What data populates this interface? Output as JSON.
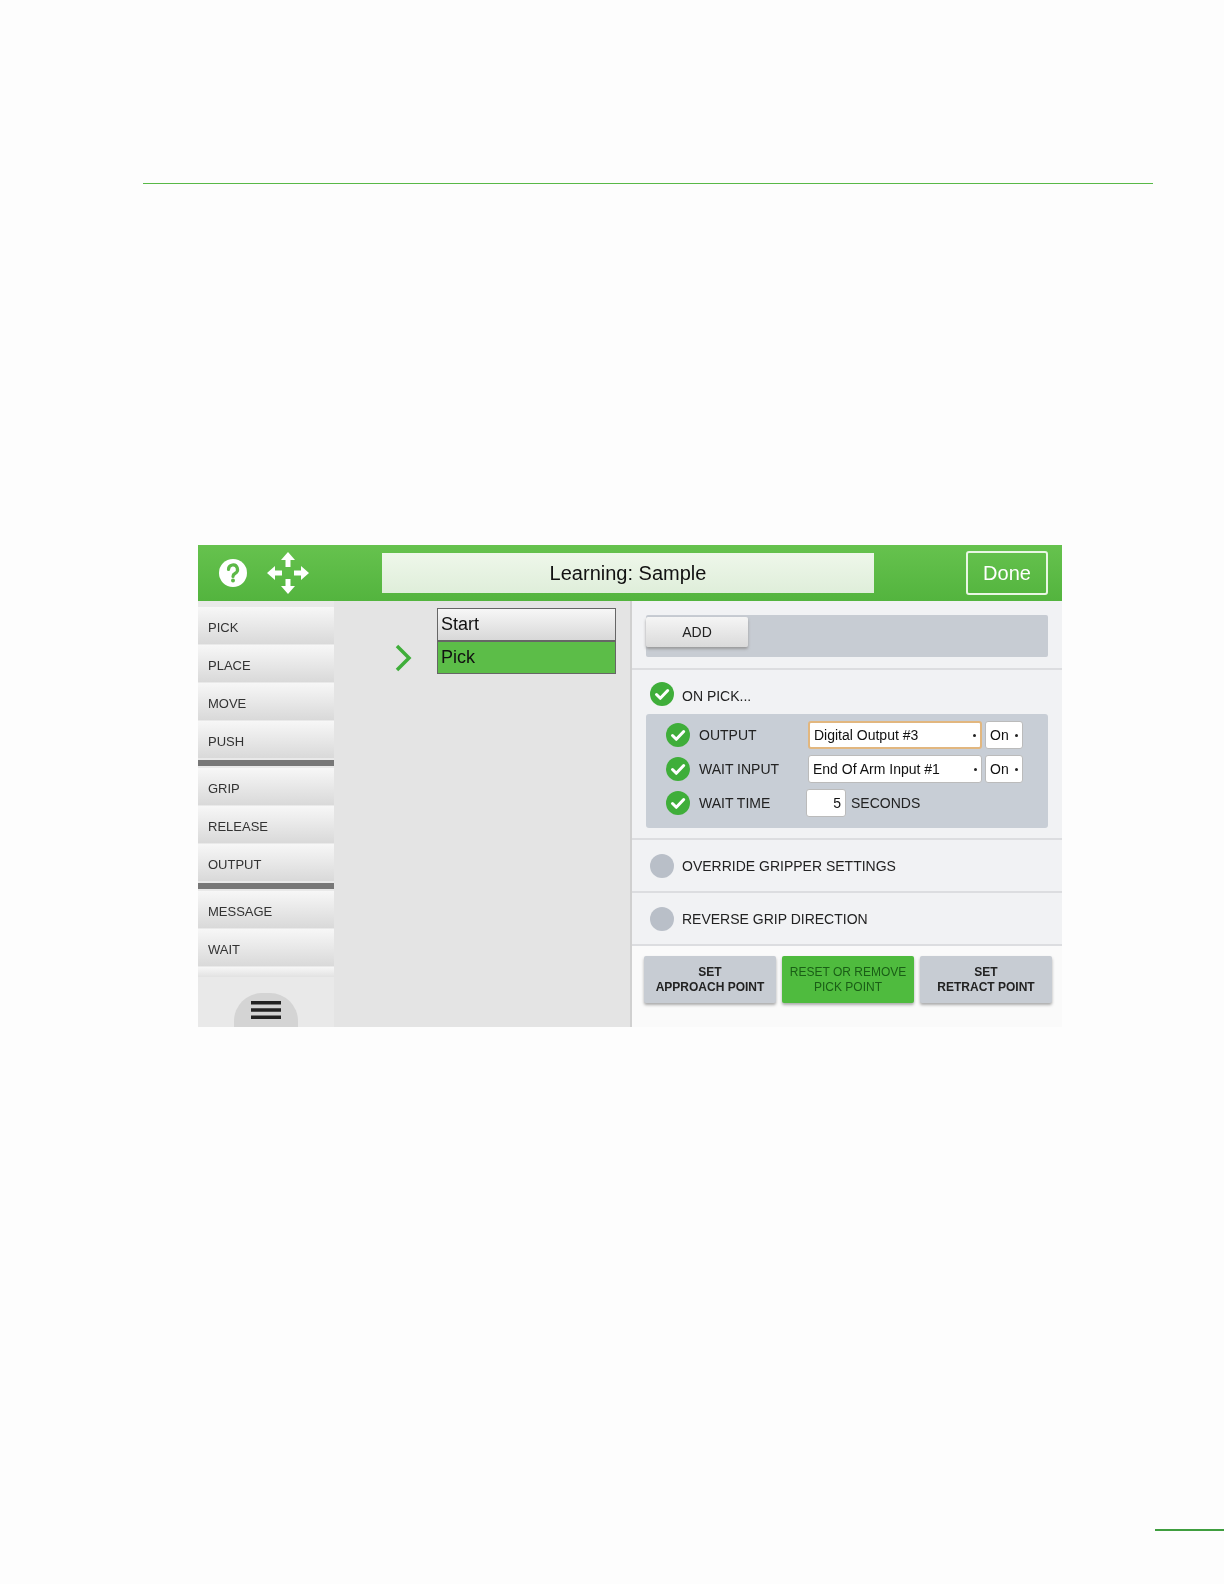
{
  "header": {
    "title": "Learning: Sample",
    "done": "Done"
  },
  "palette": {
    "groups": [
      [
        "PICK",
        "PLACE",
        "MOVE",
        "PUSH"
      ],
      [
        "GRIP",
        "RELEASE",
        "OUTPUT"
      ],
      [
        "MESSAGE",
        "WAIT"
      ]
    ]
  },
  "sequence": [
    {
      "label": "Start",
      "selected": false
    },
    {
      "label": "Pick",
      "selected": true
    }
  ],
  "add_button": "ADD",
  "on_pick": {
    "label": "ON PICK...",
    "checked": true,
    "rows": [
      {
        "kind": "select",
        "label": "OUTPUT",
        "checked": true,
        "value": "Digital Output #3",
        "focused": true,
        "state": "On"
      },
      {
        "kind": "select",
        "label": "WAIT INPUT",
        "checked": true,
        "value": "End Of Arm Input #1",
        "focused": false,
        "state": "On"
      },
      {
        "kind": "number",
        "label": "WAIT TIME",
        "checked": true,
        "value": "5",
        "unit": "SECONDS"
      }
    ]
  },
  "options": [
    {
      "label": "OVERRIDE GRIPPER SETTINGS",
      "checked": false
    },
    {
      "label": "REVERSE GRIP DIRECTION",
      "checked": false
    }
  ],
  "actions": [
    {
      "label": "SET\nAPPROACH POINT",
      "selected": false
    },
    {
      "label": "RESET OR REMOVE\nPICK POINT",
      "selected": true
    },
    {
      "label": "SET\nRETRACT POINT",
      "selected": false
    }
  ]
}
